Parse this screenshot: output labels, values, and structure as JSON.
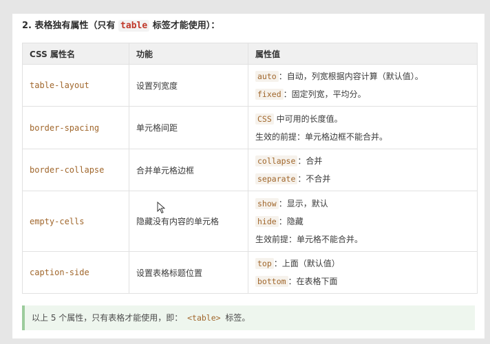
{
  "heading": {
    "prefix": "2. 表格独有属性（只有",
    "code": "table",
    "suffix": "标签才能使用）："
  },
  "table": {
    "headers": [
      "CSS 属性名",
      "功能",
      "属性值"
    ],
    "rows": [
      {
        "property": "table-layout",
        "function": "设置列宽度",
        "values": [
          {
            "code": "auto",
            "text": "：自动，列宽根据内容计算（默认值）。"
          },
          {
            "code": "fixed",
            "text": "：固定列宽，平均分。"
          }
        ]
      },
      {
        "property": "border-spacing",
        "function": "单元格间距",
        "values": [
          {
            "code": "CSS",
            "text": "中可用的长度值。"
          },
          {
            "code": "",
            "text": "生效的前提：单元格边框不能合并。"
          }
        ]
      },
      {
        "property": "border-collapse",
        "function": "合并单元格边框",
        "values": [
          {
            "code": "collapse",
            "text": "：合并"
          },
          {
            "code": "separate",
            "text": "：不合并"
          }
        ]
      },
      {
        "property": "empty-cells",
        "function": "隐藏没有内容的单元格",
        "values": [
          {
            "code": "show",
            "text": "：显示，默认"
          },
          {
            "code": "hide",
            "text": "：隐藏"
          },
          {
            "code": "",
            "text": "生效前提：单元格不能合并。"
          }
        ]
      },
      {
        "property": "caption-side",
        "function": "设置表格标题位置",
        "values": [
          {
            "code": "top",
            "text": "：上面（默认值）"
          },
          {
            "code": "bottom",
            "text": "：在表格下面"
          }
        ]
      }
    ]
  },
  "note": {
    "prefix": "以上 5 个属性，只有表格才能使用，即：",
    "code": "<table>",
    "suffix": "标签。"
  }
}
